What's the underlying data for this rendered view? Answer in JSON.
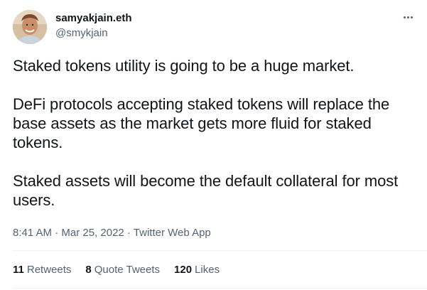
{
  "author": {
    "display_name": "samyakjain.eth",
    "handle": "@smykjain",
    "avatar_icon": "user-avatar"
  },
  "more_icon": "more-horizontal-icon",
  "tweet": {
    "paragraphs": [
      "Staked tokens utility is going to be a huge market.",
      "DeFi protocols accepting staked tokens will replace the base assets as the market gets more fluid for staked tokens.",
      "Staked assets will become the default collateral for most users."
    ],
    "meta": "8:41 AM · Mar 25, 2022 · Twitter Web App"
  },
  "stats": {
    "retweets_count": "11",
    "retweets_label": "Retweets",
    "quotes_count": "8",
    "quotes_label": "Quote Tweets",
    "likes_count": "120",
    "likes_label": "Likes"
  },
  "colors": {
    "text_primary": "#0f1419",
    "text_secondary": "#536471",
    "divider": "#eff3f4"
  }
}
